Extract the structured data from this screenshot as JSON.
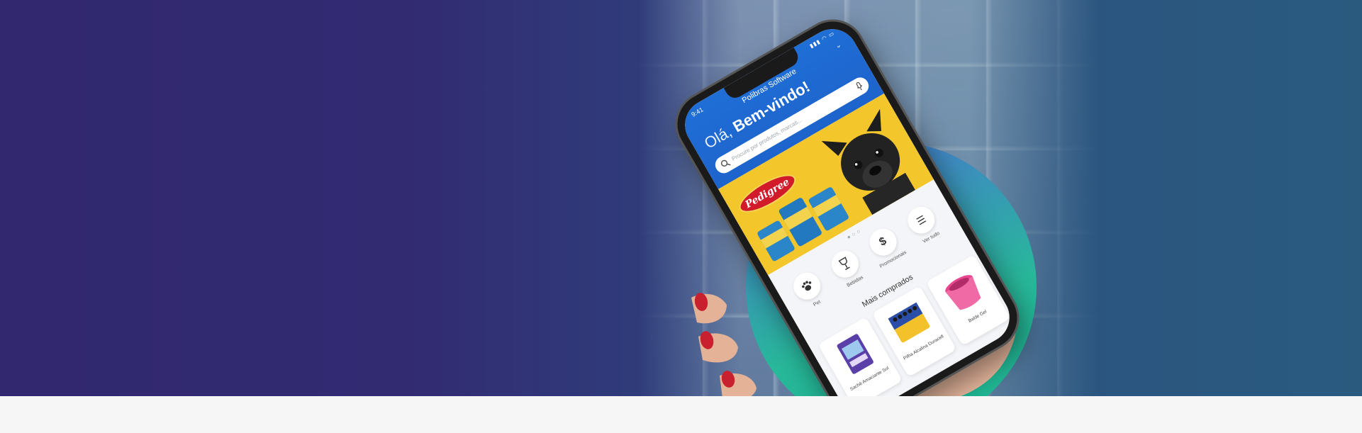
{
  "app": {
    "status_time": "9:41",
    "status_icons": "▮▮▮ ◠ ▭",
    "title": "Polibras Software",
    "greeting_hi": "Olá,",
    "greeting_welcome": "Bem-vindo!",
    "search_placeholder": "Procure por produtos, marcas...",
    "banner_brand": "Pedigree",
    "carousel_dots": "●○○",
    "categories": [
      {
        "label": "Pet",
        "icon": "paw-icon"
      },
      {
        "label": "Bebidas",
        "icon": "wine-glass-icon"
      },
      {
        "label": "Promocionais",
        "icon": "dollar-icon"
      },
      {
        "label": "Ver tudo",
        "icon": "list-icon"
      }
    ],
    "section_title": "Mais comprados",
    "products": [
      {
        "name": "Sachê Amaciante Sol"
      },
      {
        "name": "Pilha Alcalina Duracell"
      },
      {
        "name": "Balde Gel"
      }
    ]
  },
  "colors": {
    "hero_left": "#31286f",
    "hero_right": "#2a5b7f",
    "app_blue": "#1f6fd6",
    "banner_yellow": "#f3c62c",
    "ring_green": "#1bb58f"
  }
}
